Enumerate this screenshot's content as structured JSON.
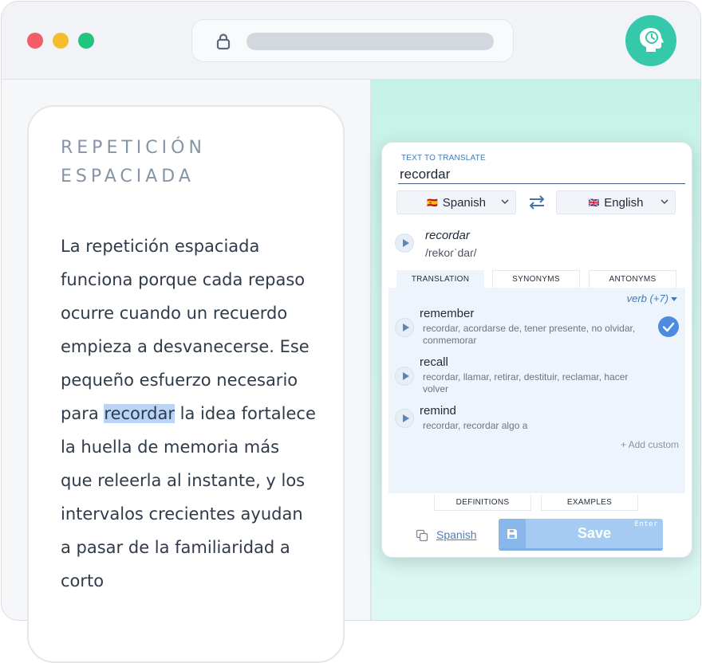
{
  "card": {
    "title": "REPETICIÓN ESPACIADA",
    "body_before": "La repetición espaciada funciona porque cada repaso ocurre cuando un recuerdo empieza a desvanecerse. Ese pequeño esfuerzo necesario para ",
    "body_highlight": "recordar",
    "body_after": " la idea fortalece la huella de memoria más que releerla al instante, y los intervalos crecientes ayudan a pasar de la familiaridad a corto"
  },
  "colors": {
    "accent": "#35c8ab",
    "highlight": "#b8d4f6",
    "save_button": "#a6cbf3"
  },
  "popup": {
    "text_label": "TEXT TO TRANSLATE",
    "text_value": "recordar",
    "source_lang": {
      "flag": "🇪🇸",
      "name": "Spanish"
    },
    "target_lang": {
      "flag": "🇬🇧",
      "name": "English"
    },
    "headword": "recordar",
    "phonetic": "/rekoɾˈdaɾ/",
    "tabs": [
      "TRANSLATION",
      "SYNONYMS",
      "ANTONYMS"
    ],
    "pos_filter": "verb (+7)",
    "translations": [
      {
        "word": "remember",
        "synonyms": "recordar, acordarse de, tener presente, no olvidar, conmemorar",
        "selected": true
      },
      {
        "word": "recall",
        "synonyms": "recordar, llamar, retirar, destituir, reclamar, hacer volver",
        "selected": false
      },
      {
        "word": "remind",
        "synonyms": "recordar, recordar algo a",
        "selected": false
      }
    ],
    "add_custom": "+ Add custom",
    "bottom_tabs": [
      "DEFINITIONS",
      "EXAMPLES"
    ],
    "deck_link": "Spanish",
    "save_label": "Save",
    "save_hint": "Enter"
  },
  "icons": {
    "lock": "lock-icon",
    "extension": "brain-clock-icon",
    "swap": "swap-arrows-icon",
    "copy": "copy-icon",
    "save": "floppy-disk-icon",
    "check": "check-circle-icon"
  }
}
